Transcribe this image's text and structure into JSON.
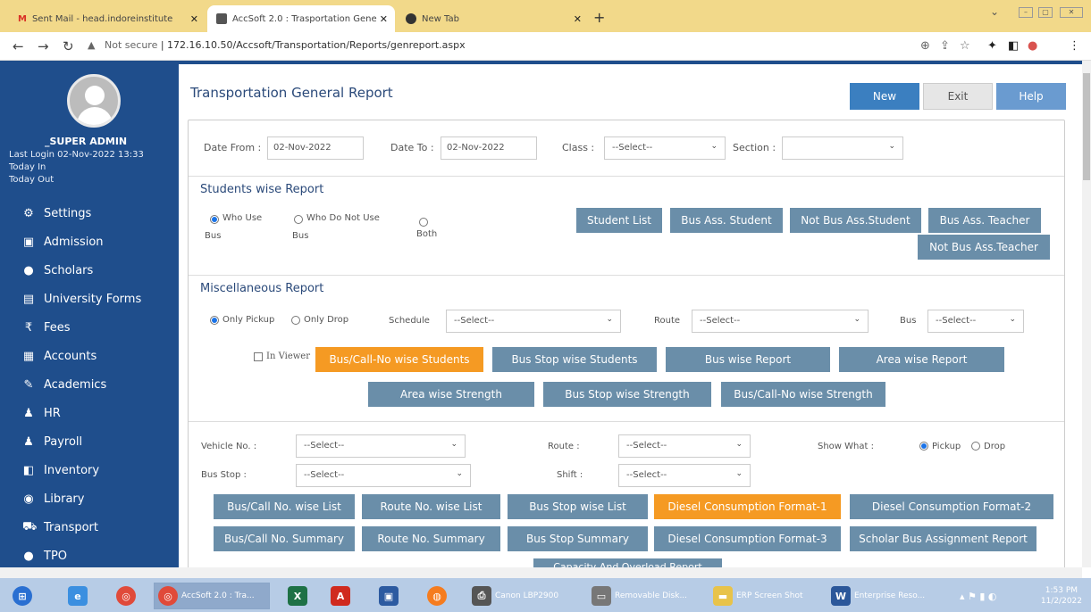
{
  "browser": {
    "tabs": [
      {
        "title": "Sent Mail - head.indoreinstitute",
        "icon": "gmail-icon"
      },
      {
        "title": "AccSoft 2.0 : Trasportation Gene",
        "icon": "accsoft-icon"
      },
      {
        "title": "New Tab",
        "icon": "newtab-icon"
      }
    ],
    "not_secure": "Not secure",
    "url": "172.16.10.50/Accsoft/Transportation/Reports/genreport.aspx"
  },
  "user": {
    "name": "_SUPER ADMIN",
    "last_login": "Last Login  02-Nov-2022 13:33",
    "today_in": "Today In",
    "today_out": "Today Out"
  },
  "menu": [
    {
      "label": "Settings",
      "icon": "gear-icon",
      "glyph": "⚙"
    },
    {
      "label": "Admission",
      "icon": "admission-icon",
      "glyph": "▣"
    },
    {
      "label": "Scholars",
      "icon": "user-icon",
      "glyph": "●"
    },
    {
      "label": "University Forms",
      "icon": "form-icon",
      "glyph": "▤"
    },
    {
      "label": "Fees",
      "icon": "rupee-icon",
      "glyph": "₹"
    },
    {
      "label": "Accounts",
      "icon": "calculator-icon",
      "glyph": "▦"
    },
    {
      "label": "Academics",
      "icon": "pen-icon",
      "glyph": "✎"
    },
    {
      "label": "HR",
      "icon": "users-icon",
      "glyph": "♟"
    },
    {
      "label": "Payroll",
      "icon": "users-icon",
      "glyph": "♟"
    },
    {
      "label": "Inventory",
      "icon": "box-icon",
      "glyph": "◧"
    },
    {
      "label": "Library",
      "icon": "library-icon",
      "glyph": "◉"
    },
    {
      "label": "Transport",
      "icon": "car-icon",
      "glyph": "⛟"
    },
    {
      "label": "TPO",
      "icon": "user-icon",
      "glyph": "●"
    }
  ],
  "page": {
    "title": "Transportation General Report",
    "new": "New",
    "exit": "Exit",
    "help": "Help"
  },
  "filters": {
    "date_from_label": "Date From :",
    "date_from": "02-Nov-2022",
    "date_to_label": "Date To :",
    "date_to": "02-Nov-2022",
    "class_label": "Class :",
    "class_value": "--Select--",
    "section_label": "Section :",
    "section_value": ""
  },
  "students": {
    "heading": "Students wise Report",
    "who_use_1": "Who Use",
    "who_use_2": "Bus",
    "who_not_1": "Who Do Not Use",
    "who_not_2": "Bus",
    "both": "Both",
    "buttons": [
      "Student List",
      "Bus Ass. Student",
      "Not Bus Ass.Student",
      "Bus Ass. Teacher",
      "Not Bus Ass.Teacher"
    ]
  },
  "misc": {
    "heading": "Miscellaneous Report",
    "only_pickup": "Only Pickup",
    "only_drop": "Only Drop",
    "schedule_label": "Schedule",
    "schedule_value": "--Select--",
    "route_label": "Route",
    "route_value": "--Select--",
    "bus_label": "Bus",
    "bus_value": "--Select--",
    "in_viewer": "In Viewer",
    "buttons_row1": [
      "Bus/Call-No wise Students",
      "Bus Stop wise Students",
      "Bus wise Report",
      "Area wise Report"
    ],
    "buttons_row2": [
      "Area wise Strength",
      "Bus Stop wise Strength",
      "Bus/Call-No wise Strength"
    ]
  },
  "vehicle": {
    "vehicle_label": "Vehicle No. :",
    "vehicle_value": "--Select--",
    "route_label": "Route :",
    "route_value": "--Select--",
    "show_label": "Show What :",
    "pickup": "Pickup",
    "drop": "Drop",
    "busstop_label": "Bus Stop :",
    "busstop_value": "--Select--",
    "shift_label": "Shift :",
    "shift_value": "--Select--",
    "buttons_row1": [
      "Bus/Call No. wise List",
      "Route No. wise List",
      "Bus Stop wise List",
      "Diesel Consumption Format-1",
      "Diesel Consumption Format-2"
    ],
    "buttons_row2": [
      "Bus/Call No. Summary",
      "Route No. Summary",
      "Bus Stop Summary",
      "Diesel Consumption Format-3",
      "Scholar Bus Assignment Report"
    ],
    "partial": "Capacity And Overload Report"
  },
  "taskbar": {
    "items": [
      "AccSoft 2.0 : Tra...",
      "Canon LBP2900",
      "Removable Disk...",
      "ERP Screen Shot",
      "Enterprise Reso..."
    ],
    "time": "1:53 PM",
    "date": "11/2/2022"
  },
  "colors": {
    "sidebar": "#1f4e8c",
    "button": "#6a8ea9",
    "accent_orange": "#f59a23",
    "primary_blue": "#3b7fc0"
  }
}
